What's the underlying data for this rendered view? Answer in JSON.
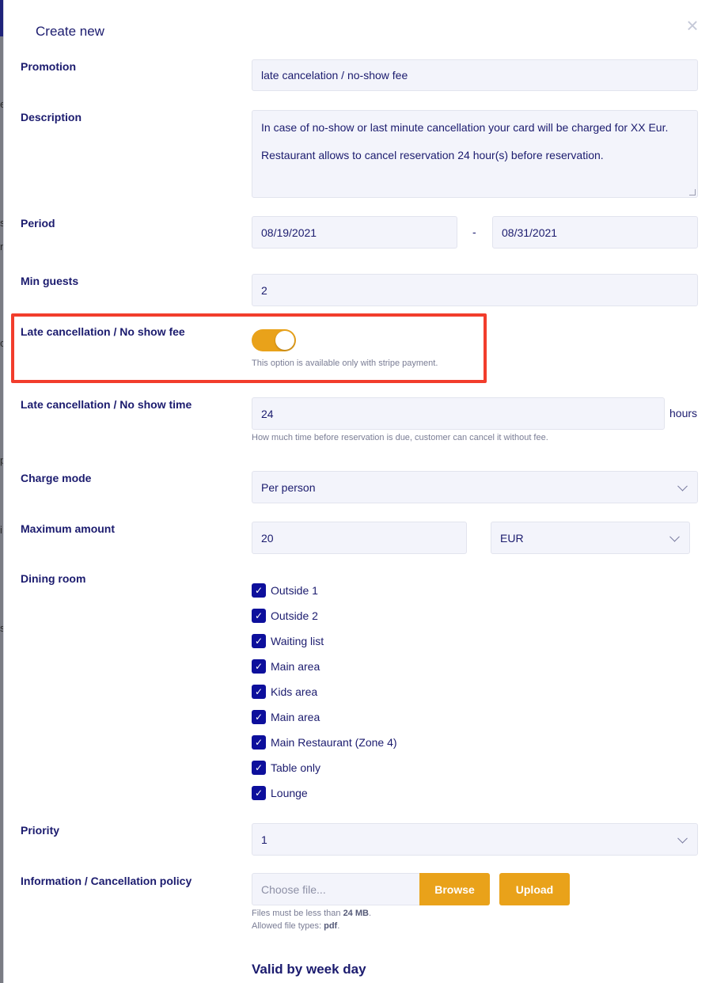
{
  "backdrop": {
    "letters": [
      "e",
      "s",
      "n",
      "c",
      "p",
      "i",
      "s"
    ]
  },
  "modal": {
    "title": "Create new",
    "close_icon": "close-icon",
    "promotion": {
      "label": "Promotion",
      "value": "late cancelation / no-show fee"
    },
    "description": {
      "label": "Description",
      "line1": "In case of no-show or last minute cancellation your card will be charged for XX Eur.",
      "line2": "Restaurant allows to cancel reservation 24 hour(s) before reservation."
    },
    "period": {
      "label": "Period",
      "start": "08/19/2021",
      "separator": "-",
      "end": "08/31/2021"
    },
    "min_guests": {
      "label": "Min guests",
      "value": "2"
    },
    "late_fee": {
      "label": "Late cancellation / No show fee",
      "enabled": true,
      "help": "This option is available only with stripe payment."
    },
    "late_time": {
      "label": "Late cancellation / No show time",
      "value": "24",
      "suffix": "hours",
      "help": "How much time before reservation is due, customer can cancel it without fee."
    },
    "charge_mode": {
      "label": "Charge mode",
      "value": "Per person"
    },
    "maximum_amount": {
      "label": "Maximum amount",
      "value": "20",
      "currency": "EUR"
    },
    "dining_room": {
      "label": "Dining room",
      "items": [
        {
          "label": "Outside 1",
          "checked": true
        },
        {
          "label": "Outside 2",
          "checked": true
        },
        {
          "label": "Waiting list",
          "checked": true
        },
        {
          "label": "Main area",
          "checked": true
        },
        {
          "label": "Kids area",
          "checked": true
        },
        {
          "label": "Main area",
          "checked": true
        },
        {
          "label": "Main Restaurant (Zone 4)",
          "checked": true
        },
        {
          "label": "Table only",
          "checked": true
        },
        {
          "label": "Lounge",
          "checked": true
        }
      ]
    },
    "priority": {
      "label": "Priority",
      "value": "1"
    },
    "policy": {
      "label": "Information / Cancellation policy",
      "placeholder": "Choose file...",
      "browse": "Browse",
      "upload": "Upload",
      "help1_prefix": "Files must be less than ",
      "help1_bold": "24 MB",
      "help1_suffix": ".",
      "help2_prefix": "Allowed file types: ",
      "help2_bold": "pdf",
      "help2_suffix": "."
    },
    "valid_by_week_day": "Valid by week day"
  },
  "colors": {
    "accent": "#e9a21a",
    "primary_text": "#1b1b6e",
    "checkbox": "#0d0f9c",
    "highlight": "#f23d2c",
    "field_bg": "#f3f4fb"
  }
}
